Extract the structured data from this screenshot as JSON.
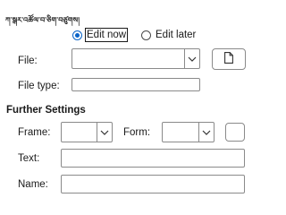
{
  "header": {
    "title": "ཀ་སྒར་འཚོལ་བ་ཅིག་བཙུགས།"
  },
  "mode": {
    "edit_now_label": "Edit now",
    "edit_later_label": "Edit later",
    "selected": "edit_now"
  },
  "file": {
    "label": "File:",
    "value": ""
  },
  "file_type": {
    "label": "File type:",
    "value": ""
  },
  "further_settings": {
    "title": "Further Settings",
    "frame_label": "Frame:",
    "frame_value": "",
    "form_label": "Form:",
    "form_value": "",
    "text_label": "Text:",
    "text_value": "",
    "name_label": "Name:",
    "name_value": ""
  },
  "icons": {
    "browse": "document-icon",
    "dropdown": "chevron-down-icon"
  }
}
